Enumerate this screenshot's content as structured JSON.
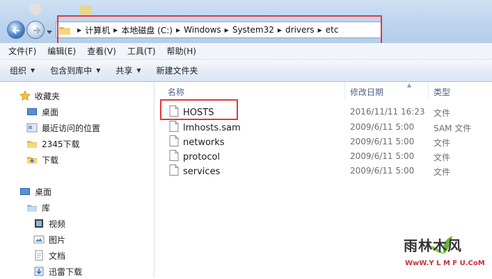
{
  "address_bar": {
    "crumbs": [
      "计算机",
      "本地磁盘 (C:)",
      "Windows",
      "System32",
      "drivers",
      "etc"
    ]
  },
  "menu": {
    "items": [
      "文件(F)",
      "编辑(E)",
      "查看(V)",
      "工具(T)",
      "帮助(H)"
    ]
  },
  "toolbar": {
    "organize": "组织",
    "include_library": "包含到库中",
    "share": "共享",
    "new_folder": "新建文件夹"
  },
  "navpane": {
    "favorites": "收藏夹",
    "fav_desktop": "桌面",
    "recent": "最近访问的位置",
    "downloads_2345": "2345下载",
    "downloads": "下载",
    "desktop": "桌面",
    "libraries": "库",
    "videos": "视频",
    "pictures": "图片",
    "documents": "文档",
    "xunlei": "迅雷下载"
  },
  "columns": {
    "name": "名称",
    "date": "修改日期",
    "type": "类型"
  },
  "files": [
    {
      "name": "HOSTS",
      "date": "2016/11/11 16:23",
      "type": "文件"
    },
    {
      "name": "lmhosts.sam",
      "date": "2009/6/11 5:00",
      "type": "SAM 文件"
    },
    {
      "name": "networks",
      "date": "2009/6/11 5:00",
      "type": "文件"
    },
    {
      "name": "protocol",
      "date": "2009/6/11 5:00",
      "type": "文件"
    },
    {
      "name": "services",
      "date": "2009/6/11 5:00",
      "type": "文件"
    }
  ],
  "watermark": {
    "brand": "雨林木风",
    "url": "WwW.Y L M F U.CoM"
  },
  "colors": {
    "highlight_box": "#e0383b",
    "header_text": "#4d6185"
  }
}
